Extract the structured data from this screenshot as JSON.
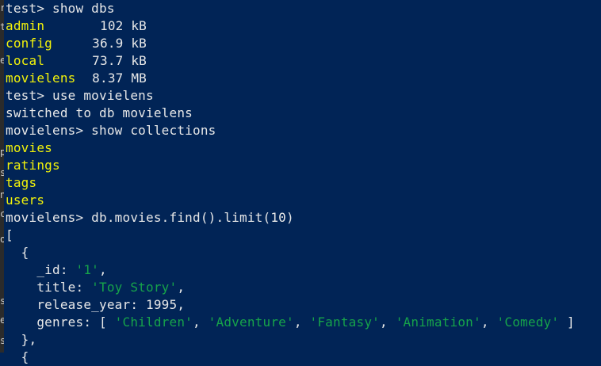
{
  "colors": {
    "background": "#012456",
    "text": "#e8e8e8",
    "highlight": "#f2f20a",
    "string": "#16a34a"
  },
  "gutter_chars": [
    "r",
    "t",
    "e",
    "p",
    "s",
    "n",
    "c",
    "o",
    "s",
    "e",
    "s"
  ],
  "terminal": {
    "cmd1": "test> show dbs",
    "dbs": [
      {
        "name": "admin",
        "size": "102 kB"
      },
      {
        "name": "config",
        "size": "36.9 kB"
      },
      {
        "name": "local",
        "size": "73.7 kB"
      },
      {
        "name": "movielens",
        "size": "8.37 MB"
      }
    ],
    "cmd2": "test> use movielens",
    "switched": "switched to db movielens",
    "cmd3": "movielens> show collections",
    "collections": [
      "movies",
      "ratings",
      "tags",
      "users"
    ],
    "cmd4": "movielens> db.movies.find().limit(10)",
    "open_bracket": "[",
    "open_brace": "  {",
    "doc": {
      "id_key": "    _id: ",
      "id_val": "'1'",
      "title_key": "    title: ",
      "title_val": "'Toy Story'",
      "year_key": "    release_year: ",
      "year_val": "1995",
      "genres_key": "    genres: [ ",
      "genres": [
        "'Children'",
        "'Adventure'",
        "'Fantasy'",
        "'Animation'",
        "'Comedy'"
      ],
      "genres_sep": ", ",
      "genres_close": " ]"
    },
    "close_brace": "  },",
    "next_brace": "  {"
  }
}
